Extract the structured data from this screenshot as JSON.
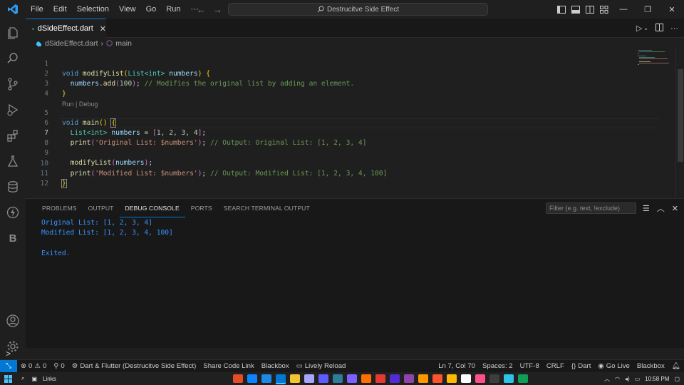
{
  "titlebar": {
    "menu": [
      "File",
      "Edit",
      "Selection",
      "View",
      "Go",
      "Run",
      "···"
    ],
    "command_center": "Destrucitve Side Effect"
  },
  "tab": {
    "label": "dSideEffect.dart",
    "close": "✕"
  },
  "breadcrumb": {
    "file": "dSideEffect.dart",
    "symbol": "main"
  },
  "editor": {
    "line_numbers": [
      "1",
      "2",
      "3",
      "4",
      "5",
      "6",
      "7",
      "8",
      "9",
      "10",
      "11",
      "12"
    ],
    "codelens": "Run | Debug",
    "code": {
      "l1_void": "void",
      "l1_fn": "modifyList",
      "l1_type": "List",
      "l1_generic": "<int>",
      "l1_param": "numbers",
      "l2_var": "numbers",
      "l2_method": "add",
      "l2_num": "100",
      "l2_comment": "// Modifies the original list by adding an element.",
      "l5_void": "void",
      "l5_fn": "main",
      "l6_type": "List<int>",
      "l6_var": "numbers",
      "l6_values": "1, 2, 3, 4",
      "l7_fn": "print",
      "l7_str": "'Original List: $numbers'",
      "l7_comment": "// Output: Original List: [1, 2, 3, 4]",
      "l9_fn": "modifyList",
      "l9_var": "numbers",
      "l10_fn": "print",
      "l10_str": "'Modified List: $numbers'",
      "l10_comment": "// Output: Modified List: [1, 2, 3, 4, 100]"
    }
  },
  "panel": {
    "tabs": [
      "PROBLEMS",
      "OUTPUT",
      "DEBUG CONSOLE",
      "PORTS",
      "SEARCH TERMINAL OUTPUT"
    ],
    "active_tab": "DEBUG CONSOLE",
    "filter_placeholder": "Filter (e.g. text, !exclude)",
    "console_lines": [
      "Original List: [1, 2, 3, 4]",
      "Modified List: [1, 2, 3, 4, 100]",
      "Exited."
    ],
    "prompt": ">"
  },
  "statusbar": {
    "errors": "0",
    "warnings": "0",
    "ports": "0",
    "debug": "Dart & Flutter (Destrucitve Side Effect)",
    "share": "Share Code Link",
    "blackbox": "Blackbox",
    "lively": "Lively Reload",
    "position": "Ln 7, Col 70",
    "spaces": "Spaces: 2",
    "encoding": "UTF-8",
    "eol": "CRLF",
    "language": "Dart",
    "golive": "Go Live",
    "blackbox_right": "Blackbox"
  },
  "taskbar": {
    "links": "Links",
    "time": "10:58 PM",
    "app_colors": [
      "#e34c26",
      "#0a84ff",
      "#1e88e5",
      "#0078d4",
      "#f4c430",
      "#a6a6ff",
      "#5c5cff",
      "#2d7d9a",
      "#7b61ff",
      "#ff6f00",
      "#e53935",
      "#512bd4",
      "#8e44ad",
      "#ff9800",
      "#fb542b",
      "#ffb900",
      "#ffffff",
      "#ff4f8b",
      "#3d3d3d",
      "#2dc3e8",
      "#0f9d58"
    ]
  },
  "colors": {
    "accent": "#0078d4",
    "console_text": "#3794ff"
  }
}
